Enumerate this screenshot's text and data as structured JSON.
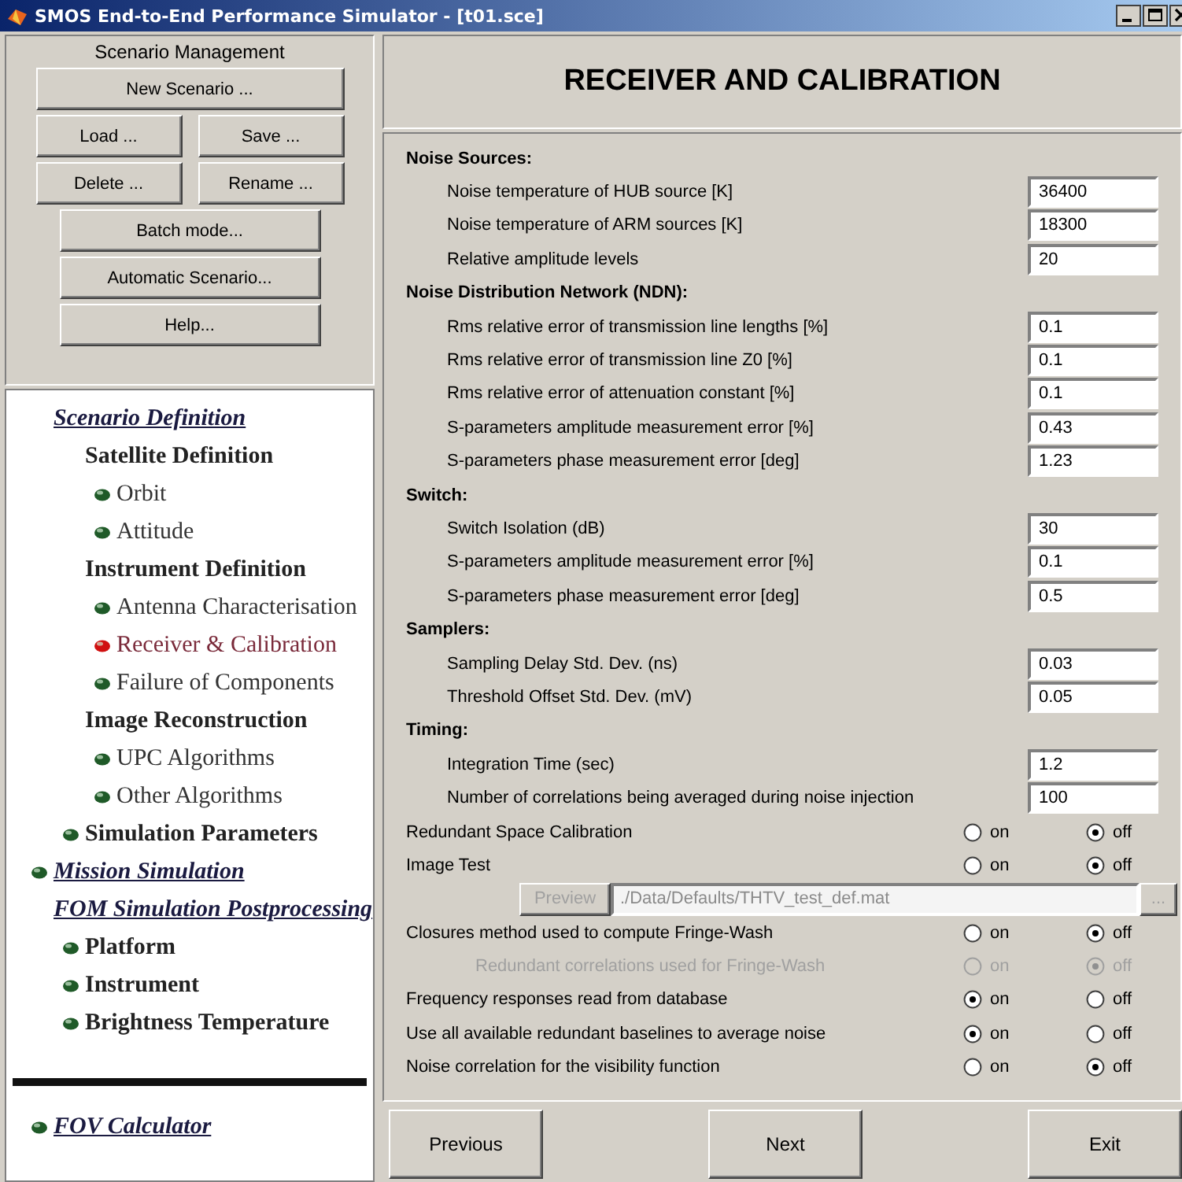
{
  "window": {
    "title": "SMOS End-to-End Performance Simulator - [t01.sce]"
  },
  "management": {
    "title": "Scenario Management",
    "rows": [
      [
        "New Scenario ..."
      ],
      [
        "Load ...",
        "Save ..."
      ],
      [
        "Delete ...",
        "Rename ..."
      ],
      [
        "Batch mode..."
      ],
      [
        "Automatic Scenario..."
      ],
      [
        "Help..."
      ]
    ]
  },
  "tree": [
    {
      "label": "Scenario Definition",
      "kind": "link",
      "bullet": false,
      "selected": false,
      "children": [
        {
          "label": "Satellite Definition",
          "kind": "heading",
          "bullet": false,
          "selected": false,
          "children": [
            {
              "label": "Orbit",
              "kind": "item",
              "bullet": true,
              "selected": false
            },
            {
              "label": "Attitude",
              "kind": "item",
              "bullet": true,
              "selected": false
            }
          ]
        },
        {
          "label": "Instrument Definition",
          "kind": "heading",
          "bullet": false,
          "selected": false,
          "children": [
            {
              "label": "Antenna Characterisation",
              "kind": "item",
              "bullet": true,
              "selected": false
            },
            {
              "label": "Receiver & Calibration",
              "kind": "item",
              "bullet": true,
              "selected": true
            },
            {
              "label": "Failure of Components",
              "kind": "item",
              "bullet": true,
              "selected": false
            }
          ]
        },
        {
          "label": "Image Reconstruction",
          "kind": "heading",
          "bullet": false,
          "selected": false,
          "children": [
            {
              "label": "UPC Algorithms",
              "kind": "item",
              "bullet": true,
              "selected": false
            },
            {
              "label": "Other Algorithms",
              "kind": "item",
              "bullet": true,
              "selected": false
            }
          ]
        },
        {
          "label": "Simulation Parameters",
          "kind": "heading",
          "bullet": true,
          "selected": false
        }
      ]
    },
    {
      "label": "Mission Simulation",
      "kind": "link",
      "bullet": true,
      "selected": false
    },
    {
      "label": "FOM Simulation Postprocessing",
      "kind": "link",
      "bullet": false,
      "selected": false,
      "children": [
        {
          "label": "Platform",
          "kind": "heading",
          "bullet": true,
          "selected": false
        },
        {
          "label": "Instrument",
          "kind": "heading",
          "bullet": true,
          "selected": false
        },
        {
          "label": "Brightness Temperature",
          "kind": "heading",
          "bullet": true,
          "selected": false
        }
      ]
    }
  ],
  "tools": [
    {
      "label": "FOV Calculator",
      "kind": "link",
      "bullet": true,
      "selected": false
    }
  ],
  "page_title": "RECEIVER AND CALIBRATION",
  "sections": [
    {
      "heading": "Noise Sources:",
      "fields": [
        {
          "label": "Noise temperature of HUB source  [K]",
          "value": "36400"
        },
        {
          "label": "Noise temperature of ARM sources [K]",
          "value": "18300"
        },
        {
          "label": "Relative amplitude levels",
          "value": "20"
        }
      ]
    },
    {
      "heading": "Noise Distribution Network (NDN):",
      "fields": [
        {
          "label": "Rms relative error of transmission line lengths [%]",
          "value": "0.1"
        },
        {
          "label": "Rms relative error of transmission line Z0 [%]",
          "value": "0.1"
        },
        {
          "label": "Rms relative error of attenuation constant [%]",
          "value": "0.1"
        },
        {
          "label": "S-parameters amplitude measurement error [%]",
          "value": "0.43"
        },
        {
          "label": "S-parameters phase measurement error [deg]",
          "value": "1.23"
        }
      ]
    },
    {
      "heading": "Switch:",
      "fields": [
        {
          "label": "Switch Isolation (dB)",
          "value": "30"
        },
        {
          "label": "S-parameters amplitude measurement error [%]",
          "value": "0.1"
        },
        {
          "label": "S-parameters phase measurement error [deg]",
          "value": "0.5"
        }
      ]
    },
    {
      "heading": "Samplers:",
      "fields": [
        {
          "label": "Sampling Delay Std. Dev. (ns)",
          "value": "0.03"
        },
        {
          "label": "Threshold Offset Std. Dev. (mV)",
          "value": "0.05"
        }
      ]
    },
    {
      "heading": "Timing:",
      "fields": [
        {
          "label": "Integration Time (sec)",
          "value": "1.2"
        },
        {
          "label": "Number of correlations being averaged during noise injection",
          "value": "100"
        }
      ]
    }
  ],
  "options": [
    {
      "kind": "toggle",
      "label": "Redundant Space Calibration",
      "disabled": false,
      "choices": [
        {
          "label": "on",
          "selected": false
        },
        {
          "label": "off",
          "selected": true
        }
      ]
    },
    {
      "kind": "toggle",
      "label": "Image Test",
      "disabled": false,
      "choices": [
        {
          "label": "on",
          "selected": false
        },
        {
          "label": "off",
          "selected": true
        }
      ]
    },
    {
      "kind": "file",
      "button": "Preview",
      "disabled": true,
      "path": "./Data/Defaults/THTV_test_def.mat",
      "browse": "..."
    },
    {
      "kind": "toggle",
      "label": "Closures method used to compute Fringe-Wash",
      "disabled": false,
      "choices": [
        {
          "label": "on",
          "selected": false
        },
        {
          "label": "off",
          "selected": true
        }
      ],
      "children": [
        {
          "kind": "toggle",
          "label": "Redundant correlations used for Fringe-Wash",
          "disabled": true,
          "choices": [
            {
              "label": "on",
              "selected": false
            },
            {
              "label": "off",
              "selected": true
            }
          ]
        }
      ]
    },
    {
      "kind": "toggle",
      "label": "Frequency responses read from database",
      "disabled": false,
      "choices": [
        {
          "label": "on",
          "selected": true
        },
        {
          "label": "off",
          "selected": false
        }
      ]
    },
    {
      "kind": "toggle",
      "label": "Use all available redundant baselines to average noise",
      "disabled": false,
      "choices": [
        {
          "label": "on",
          "selected": true
        },
        {
          "label": "off",
          "selected": false
        }
      ]
    },
    {
      "kind": "toggle",
      "label": "Noise correlation for the visibility function",
      "disabled": false,
      "choices": [
        {
          "label": "on",
          "selected": false
        },
        {
          "label": "off",
          "selected": true
        }
      ]
    }
  ],
  "footer": [
    "Previous",
    "Next",
    "Exit"
  ]
}
